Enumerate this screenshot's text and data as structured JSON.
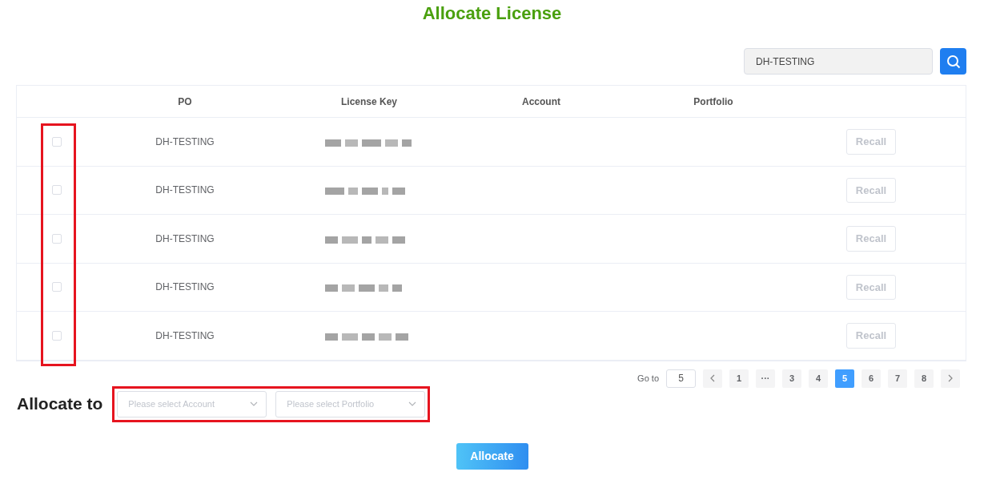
{
  "title": "Allocate License",
  "search": {
    "value": "DH-TESTING"
  },
  "table": {
    "columns": [
      "PO",
      "License Key",
      "Account",
      "Portfolio"
    ],
    "checkbox_column_highlighted": true,
    "rows": [
      {
        "checked": false,
        "po": "DH-TESTING",
        "action": "Recall",
        "action_disabled": true
      },
      {
        "checked": false,
        "po": "DH-TESTING",
        "action": "Recall",
        "action_disabled": true
      },
      {
        "checked": false,
        "po": "DH-TESTING",
        "action": "Recall",
        "action_disabled": true
      },
      {
        "checked": false,
        "po": "DH-TESTING",
        "action": "Recall",
        "action_disabled": true
      },
      {
        "checked": false,
        "po": "DH-TESTING",
        "action": "Recall",
        "action_disabled": true
      }
    ]
  },
  "pagination": {
    "goto_label": "Go to",
    "goto_value": "5",
    "pages": [
      {
        "label": "1",
        "selected": false
      },
      {
        "label": "···",
        "selected": false
      },
      {
        "label": "3",
        "selected": false
      },
      {
        "label": "4",
        "selected": false
      },
      {
        "label": "5",
        "selected": true
      },
      {
        "label": "6",
        "selected": false
      },
      {
        "label": "7",
        "selected": false
      },
      {
        "label": "8",
        "selected": false
      }
    ]
  },
  "allocate": {
    "label": "Allocate to",
    "highlighted": true,
    "selects": [
      {
        "placeholder": "Please select Account"
      },
      {
        "placeholder": "Please select Portfolio"
      }
    ],
    "button": "Allocate"
  }
}
